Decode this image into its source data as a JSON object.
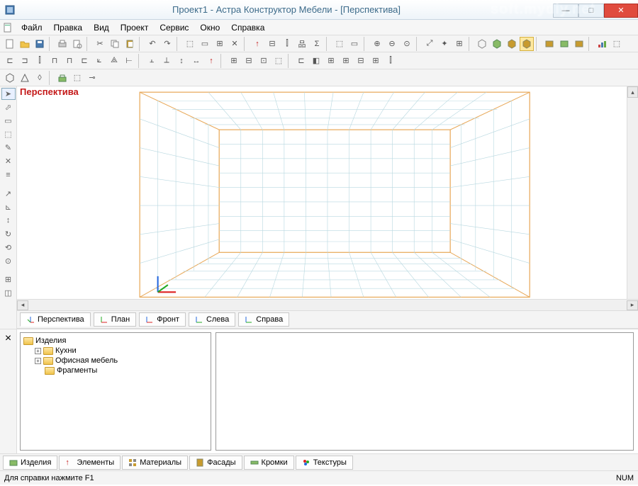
{
  "window": {
    "title": "Проект1 - Астра Конструктор Мебели - [Перспектива]"
  },
  "menu": {
    "items": [
      "Файл",
      "Правка",
      "Вид",
      "Проект",
      "Сервис",
      "Окно",
      "Справка"
    ]
  },
  "viewport": {
    "label": "Перспектива"
  },
  "viewtabs": {
    "items": [
      "Перспектива",
      "План",
      "Фронт",
      "Слева",
      "Справа"
    ]
  },
  "tree": {
    "root": "Изделия",
    "children": [
      {
        "label": "Кухни",
        "expandable": true
      },
      {
        "label": "Офисная мебель",
        "expandable": true
      },
      {
        "label": "Фрагменты",
        "expandable": false
      }
    ]
  },
  "bottomtabs": {
    "items": [
      "Изделия",
      "Элементы",
      "Материалы",
      "Фасады",
      "Кромки",
      "Текстуры"
    ]
  },
  "status": {
    "help": "Для справки нажмите F1",
    "num": "NUM"
  },
  "watermark": "soft.mydiy.net"
}
